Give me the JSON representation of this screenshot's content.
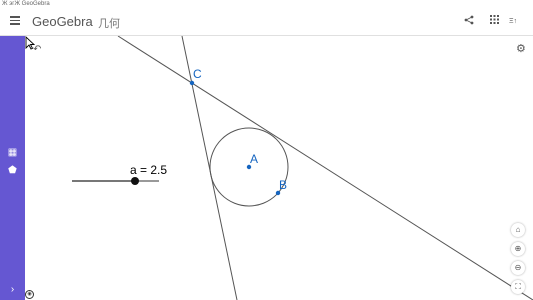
{
  "window": {
    "title": "Ж эгЖ GeoGebra"
  },
  "header": {
    "logo": "GeoGebra",
    "subtitle": "几何",
    "icons": [
      "menu-icon",
      "share-icon",
      "grid-icon",
      "view-icon"
    ],
    "view_label": "Ξ↑"
  },
  "sidebar": {
    "items": [
      {
        "icon": "calculator-icon",
        "glyph": "▦"
      },
      {
        "icon": "shapes-icon",
        "glyph": "⬟"
      },
      {
        "icon": "expand-icon",
        "glyph": "›"
      }
    ]
  },
  "canvas": {
    "points": [
      {
        "name": "C",
        "label": "C"
      },
      {
        "name": "A",
        "label": "A"
      },
      {
        "name": "B",
        "label": "B"
      }
    ],
    "slider": {
      "label": "a = 2.5",
      "value": 2.5
    },
    "controls": {
      "undo": "↶",
      "settings": "⚙",
      "home": "⌂",
      "zoom_in": "⊕",
      "zoom_out": "⊖",
      "fullscreen": "⛶",
      "corner": "◉"
    }
  },
  "colors": {
    "sidebar": "#6557d2",
    "point": "#1565c0",
    "line": "#555555"
  }
}
